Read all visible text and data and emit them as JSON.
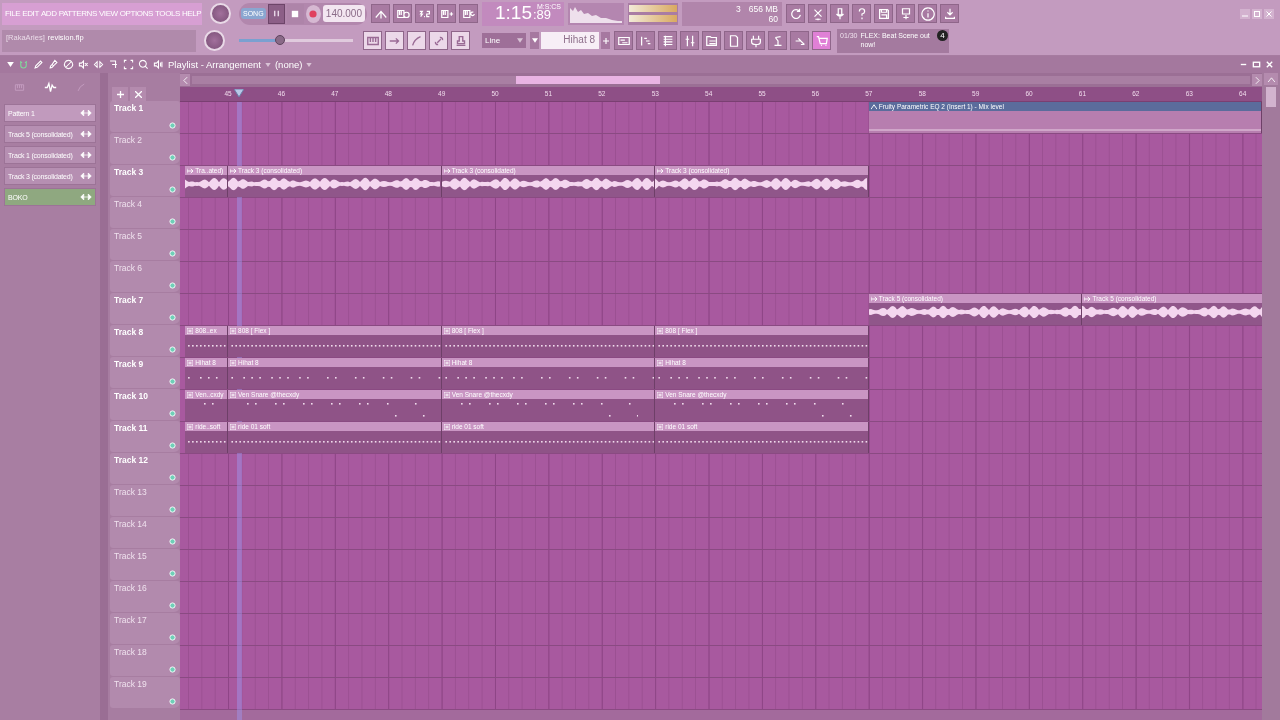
{
  "menu": [
    "FILE",
    "EDIT",
    "ADD",
    "PATTERNS",
    "VIEW",
    "OPTIONS",
    "TOOLS",
    "HELP"
  ],
  "hint": {
    "user": "[RakaAries]",
    "file": "revision.flp"
  },
  "transport": {
    "mode": "SONG",
    "playing": true,
    "tempo": "140.000"
  },
  "master_volume": {
    "level": 0.36
  },
  "time": {
    "value": "1:15",
    "centis": ":89",
    "unit": "M:S:CS"
  },
  "cpu": {
    "voices": "3",
    "memory": "656 MB",
    "polyphony": "60"
  },
  "snap": "Line",
  "pattern_selector": "Hihat 8",
  "news": {
    "counter": "01/30",
    "text": "FLEX: Beat Scene out now!",
    "badge": "4"
  },
  "playlist": {
    "title": "Playlist - Arrangement",
    "pattern": "(none)",
    "picker": [
      {
        "kind": "pattern",
        "label": "Pattern 1"
      },
      {
        "kind": "audio",
        "label": "Track 5 (consolidated)"
      },
      {
        "kind": "audio",
        "label": "Track 1 (consolidated)"
      },
      {
        "kind": "audio",
        "label": "Track 3 (consolidated)"
      },
      {
        "kind": "automation",
        "label": "BOKO"
      }
    ],
    "ruler": [
      "45",
      "46",
      "47",
      "48",
      "49",
      "50",
      "51",
      "52",
      "53",
      "54",
      "55",
      "56",
      "57",
      "58",
      "59",
      "60",
      "61",
      "62",
      "63",
      "64"
    ],
    "tracks": [
      {
        "name": "Track 1",
        "empty": false,
        "clips": [
          {
            "kind": "gap"
          },
          {
            "kind": "gap"
          },
          {
            "kind": "gap"
          },
          {
            "kind": "gap"
          },
          {
            "kind": "automation",
            "label": "Fruity Parametric EQ 2 (Insert 1) - Mix level"
          }
        ]
      },
      {
        "name": "Track 2",
        "empty": true
      },
      {
        "name": "Track 3",
        "empty": false,
        "clips": [
          {
            "kind": "audio",
            "label": "Tra..ated)"
          },
          {
            "kind": "audio",
            "label": "Track 3 (consolidated)"
          },
          {
            "kind": "audio",
            "label": "Track 3 (consolidated)"
          },
          {
            "kind": "audio",
            "label": "Track 3 (consolidated)"
          }
        ]
      },
      {
        "name": "Track 4",
        "empty": true
      },
      {
        "name": "Track 5",
        "empty": true
      },
      {
        "name": "Track 6",
        "empty": true
      },
      {
        "name": "Track 7",
        "empty": false,
        "clips": [
          {
            "kind": "gap"
          },
          {
            "kind": "gap"
          },
          {
            "kind": "gap"
          },
          {
            "kind": "gap"
          },
          {
            "kind": "audio",
            "label": "Track 5 (consolidated)"
          },
          {
            "kind": "audio",
            "label": "Track 5 (consolidated)"
          }
        ]
      },
      {
        "name": "Track 8",
        "empty": false,
        "clips": [
          {
            "kind": "pattern",
            "label": "808..ex"
          },
          {
            "kind": "pattern",
            "label": "808 [ Flex ]"
          },
          {
            "kind": "pattern",
            "label": "808 [ Flex ]"
          },
          {
            "kind": "pattern",
            "label": "808 [ Flex ]"
          }
        ]
      },
      {
        "name": "Track 9",
        "empty": false,
        "clips": [
          {
            "kind": "pattern",
            "label": "Hihat 8"
          },
          {
            "kind": "pattern",
            "label": "Hihat 8"
          },
          {
            "kind": "pattern",
            "label": "Hihat 8"
          },
          {
            "kind": "pattern",
            "label": "Hihat 8"
          }
        ]
      },
      {
        "name": "Track 10",
        "empty": false,
        "clips": [
          {
            "kind": "pattern",
            "label": "Ven..cxdy"
          },
          {
            "kind": "pattern",
            "label": "Ven Snare @thecxdy"
          },
          {
            "kind": "pattern",
            "label": "Ven Snare @thecxdy"
          },
          {
            "kind": "pattern",
            "label": "Ven Snare @thecxdy"
          }
        ]
      },
      {
        "name": "Track 11",
        "empty": false,
        "clips": [
          {
            "kind": "pattern",
            "label": "ride..soft"
          },
          {
            "kind": "pattern",
            "label": "ride 01 soft"
          },
          {
            "kind": "pattern",
            "label": "ride 01 soft"
          },
          {
            "kind": "pattern",
            "label": "ride 01 soft"
          }
        ]
      },
      {
        "name": "Track 12",
        "empty": false
      },
      {
        "name": "Track 13",
        "empty": true
      },
      {
        "name": "Track 14",
        "empty": true
      },
      {
        "name": "Track 15",
        "empty": true
      },
      {
        "name": "Track 16",
        "empty": true
      },
      {
        "name": "Track 17",
        "empty": true
      },
      {
        "name": "Track 18",
        "empty": true
      },
      {
        "name": "Track 19",
        "empty": true
      }
    ]
  }
}
